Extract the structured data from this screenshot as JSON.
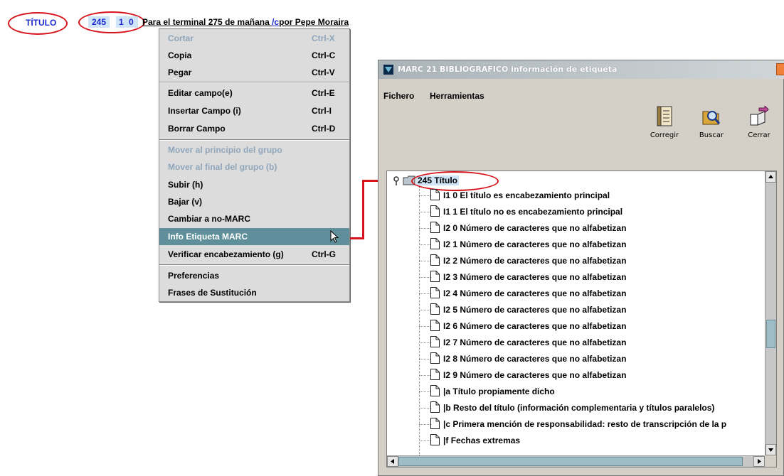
{
  "field": {
    "name": "TÍTULO",
    "tag": "245",
    "indicators": "1 0",
    "text_pre": "Para el terminal 275 de mañana ",
    "subfield_code": "/c",
    "text_post": "por Pepe Moraira"
  },
  "menu": {
    "items": [
      {
        "label": "Cortar",
        "shortcut": "Ctrl-X",
        "disabled": true
      },
      {
        "label": "Copia",
        "shortcut": "Ctrl-C"
      },
      {
        "label": "Pegar",
        "shortcut": "Ctrl-V"
      },
      {
        "label": "Editar campo(e)",
        "shortcut": "Ctrl-E"
      },
      {
        "label": "Insertar Campo (i)",
        "shortcut": "Ctrl-I"
      },
      {
        "label": "Borrar Campo",
        "shortcut": "Ctrl-D"
      },
      {
        "label": "Mover al principio del grupo",
        "disabled": true
      },
      {
        "label": "Mover al final del grupo (b)",
        "disabled": true
      },
      {
        "label": "Subir (h)"
      },
      {
        "label": "Bajar (v)"
      },
      {
        "label": "Cambiar a no-MARC"
      },
      {
        "label": "Info Etiqueta MARC",
        "highlighted": true
      },
      {
        "label": "Verificar encabezamiento (g)",
        "shortcut": "Ctrl-G"
      },
      {
        "label": "Preferencias"
      },
      {
        "label": "Frases de Sustitución"
      }
    ]
  },
  "window": {
    "title": "MARC 21 BIBLIOGRAFICO información de etiqueta",
    "menus": [
      "Fichero",
      "Herramientas"
    ],
    "toolbar": [
      "Corregir",
      "Buscar",
      "Cerrar"
    ],
    "tree_root": "245 Título",
    "tree_items": [
      "I1 0 El título es encabezamiento principal",
      "I1 1 El título no es encabezamiento principal",
      "I2 0 Número de caracteres que no alfabetizan",
      "I2 1 Número de caracteres que no alfabetizan",
      "I2 2 Número de caracteres que no alfabetizan",
      "I2 3 Número de caracteres que no alfabetizan",
      "I2 4 Número de caracteres que no alfabetizan",
      "I2 5 Número de caracteres que no alfabetizan",
      "I2 6 Número de caracteres que no alfabetizan",
      "I2 7 Número de caracteres que no alfabetizan",
      "I2 8 Número de caracteres que no alfabetizan",
      "I2 9 Número de caracteres que no alfabetizan",
      "|a Título propiamente dicho",
      "|b Resto del título (información complementaria y títulos paralelos)",
      "|c Primera mención de responsabilidad: resto de transcripción de la p",
      "|f Fechas extremas"
    ]
  },
  "colors": {
    "accent_blue": "#1d2bd0",
    "highlight": "#5e8f9a",
    "annotation_red": "#d6141b"
  },
  "icons": [
    "cursor-arrow-icon",
    "window-app-icon",
    "close-icon",
    "corregir-icon",
    "buscar-icon",
    "cerrar-icon",
    "folder-icon",
    "document-icon",
    "key-icon"
  ]
}
